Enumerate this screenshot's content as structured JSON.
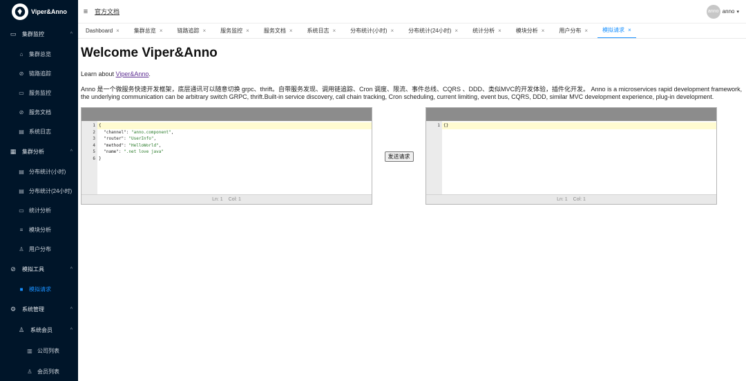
{
  "app": {
    "logo_text": "Viper&Anno",
    "docs_link": "官方文档",
    "user_avatar_text": "anno",
    "user_name": "anno"
  },
  "sidebar": {
    "groups": [
      {
        "label": "集群监控",
        "icon": "desktop-icon",
        "items": [
          {
            "label": "集群总览",
            "icon": "cluster-icon"
          },
          {
            "label": "链路追踪",
            "icon": "link-icon"
          },
          {
            "label": "服务监控",
            "icon": "monitor-icon"
          },
          {
            "label": "服务文档",
            "icon": "doc-icon"
          },
          {
            "label": "系统日志",
            "icon": "log-icon"
          }
        ]
      },
      {
        "label": "集群分析",
        "icon": "analysis-icon",
        "items": [
          {
            "label": "分布统计(小时)",
            "icon": "chart-icon"
          },
          {
            "label": "分布统计(24小时)",
            "icon": "chart-icon"
          },
          {
            "label": "统计分析",
            "icon": "stats-icon"
          },
          {
            "label": "模块分析",
            "icon": "sliders-icon"
          },
          {
            "label": "用户分布",
            "icon": "user-icon"
          }
        ]
      },
      {
        "label": "模拟工具",
        "icon": "tool-icon",
        "items": [
          {
            "label": "模拟请求",
            "icon": "request-icon",
            "active": true
          }
        ]
      },
      {
        "label": "系统管理",
        "icon": "gear-icon",
        "items": []
      },
      {
        "label": "系统会员",
        "icon": "user-icon",
        "sub": [
          {
            "label": "公司列表",
            "icon": "company-icon"
          },
          {
            "label": "会员列表",
            "icon": "user-icon"
          }
        ]
      }
    ]
  },
  "tabs": [
    {
      "label": "Dashboard"
    },
    {
      "label": "集群总览"
    },
    {
      "label": "链路追踪"
    },
    {
      "label": "服务监控"
    },
    {
      "label": "服务文档"
    },
    {
      "label": "系统日志"
    },
    {
      "label": "分布统计(小时)"
    },
    {
      "label": "分布统计(24小时)"
    },
    {
      "label": "统计分析"
    },
    {
      "label": "模块分析"
    },
    {
      "label": "用户分布"
    },
    {
      "label": "模拟请求",
      "active": true
    }
  ],
  "content": {
    "title": "Welcome Viper&Anno",
    "learn_prefix": "Learn about ",
    "learn_link": "Viper&Anno",
    "learn_suffix": ".",
    "description": "Anno 是一个微服务快速开发框架，底层通讯可以随意切换 grpc、thrift。自带服务发现、调用链追踪、Cron 调度、限流、事件总线、CQRS 、DDD、类似MVC的开发体验，插件化开发。 Anno is a microservices rapid development framework, the underlying communication can be arbitrary switch GRPC, thrift.Built-in service discovery, call chain tracking, Cron scheduling, current limiting, event bus, CQRS, DDD, similar MVC development experience, plug-in development."
  },
  "request_editor": {
    "line_numbers": [
      "1",
      "2",
      "3",
      "4",
      "5",
      "6"
    ],
    "lines": [
      "{",
      "  \"channel\": \"anno.component\",",
      "  \"router\": \"UserInfo\",",
      "  \"method\": \"HelloWorld\",",
      "  \"name\": \".net love java\"",
      "}"
    ],
    "status_ln": "Ln: 1",
    "status_col": "Col: 1"
  },
  "response_editor": {
    "line_numbers": [
      "1"
    ],
    "lines": [
      "{}"
    ],
    "status_ln": "Ln: 1",
    "status_col": "Col: 1"
  },
  "send_button": "发送请求",
  "colors": {
    "sidebar_bg": "#001529",
    "accent": "#1890ff",
    "editor_header": "#8c8c8c",
    "string": "#2a7b2a"
  }
}
